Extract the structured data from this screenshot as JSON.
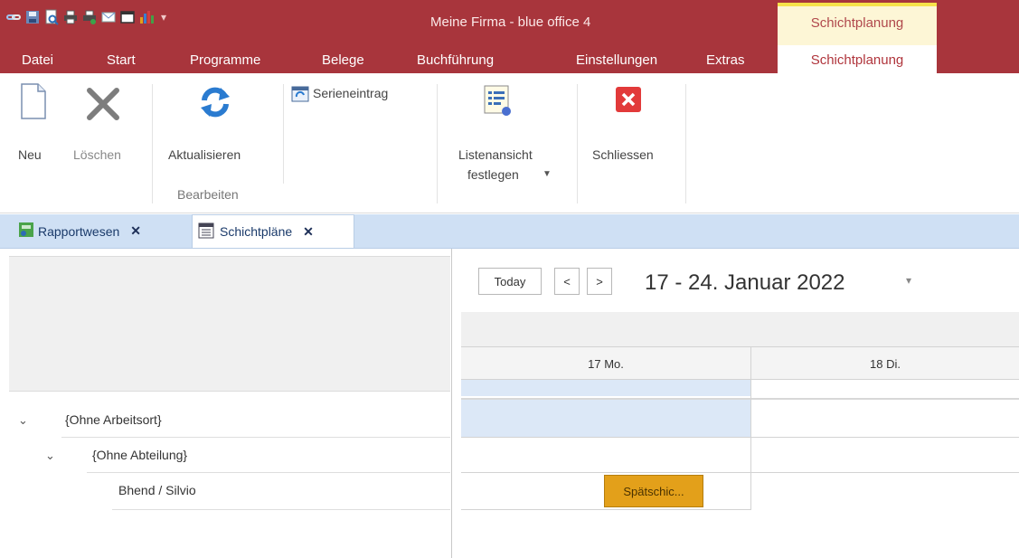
{
  "app": {
    "title": "Meine Firma - blue office 4",
    "context_tab_group": "Schichtplanung"
  },
  "qat_icons": [
    "link-icon",
    "save-icon",
    "print-preview-icon",
    "print-icon",
    "print-setup-icon",
    "email-icon",
    "window-icon",
    "chart-icon",
    "qat-dropdown-icon"
  ],
  "menu": {
    "items": [
      "Datei",
      "Start",
      "Programme",
      "Belege",
      "Buchführung",
      "Einstellungen",
      "Extras"
    ],
    "active": "Schichtplanung"
  },
  "ribbon": {
    "new_label": "Neu",
    "delete_label": "Löschen",
    "refresh_label": "Aktualisieren",
    "series_label": "Serieneintrag",
    "group_edit_label": "Bearbeiten",
    "list_view_label_1": "Listenansicht",
    "list_view_label_2": "festlegen",
    "close_label": "Schliessen"
  },
  "tabs": [
    {
      "label": "Rapportwesen",
      "active": false
    },
    {
      "label": "Schichtpläne",
      "active": true
    }
  ],
  "tree": {
    "rows": [
      {
        "label": "{Ohne Arbeitsort}",
        "level": 0,
        "expanded": true
      },
      {
        "label": "{Ohne Abteilung}",
        "level": 1,
        "expanded": true
      },
      {
        "label": "Bhend / Silvio",
        "level": 2,
        "expanded": false
      }
    ]
  },
  "scheduler": {
    "today_label": "Today",
    "prev_label": "<",
    "next_label": ">",
    "range_title": "17 - 24. Januar 2022",
    "days": [
      "17 Mo.",
      "18 Di."
    ],
    "appointment_label": "Spätschic..."
  },
  "colors": {
    "titlebar": "#a8353c",
    "context_tab_bg": "#fdf6d6",
    "context_tab_accent": "#f6e24a",
    "tabstrip": "#cfe0f4",
    "appointment": "#e3a01a",
    "selection": "#dce8f7"
  }
}
